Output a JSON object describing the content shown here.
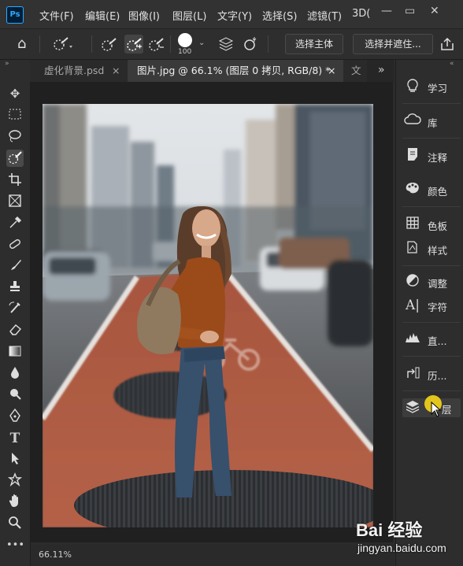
{
  "app": {
    "logo": "Ps",
    "menus": [
      "文件(F)",
      "编辑(E)",
      "图像(I)",
      "图层(L)",
      "文字(Y)",
      "选择(S)",
      "滤镜(T)",
      "3D("
    ]
  },
  "options_bar": {
    "brush_size": "100",
    "select_subject_label": "选择主体",
    "select_mask_label": "选择并遮住..."
  },
  "tabs": [
    {
      "label": "虚化背景.psd",
      "close": "×",
      "active": false
    },
    {
      "label": "图片.jpg @ 66.1% (图层 0 拷贝, RGB/8) *",
      "close": "×",
      "active": true
    },
    {
      "label": "文",
      "active": false
    }
  ],
  "tabs_overflow": "»",
  "panels": [
    {
      "icon": "lightbulb-icon",
      "label": "学习"
    },
    {
      "icon": "library-icon",
      "label": "库"
    },
    {
      "icon": "notes-icon",
      "label": "注释"
    },
    {
      "icon": "color-icon",
      "label": "颜色"
    },
    {
      "icon": "swatches-icon",
      "label": "色板"
    },
    {
      "icon": "styles-icon",
      "label": "样式"
    },
    {
      "icon": "adjustments-icon",
      "label": "调整"
    },
    {
      "icon": "character-icon",
      "label": "字符"
    },
    {
      "icon": "histogram-icon",
      "label": "直..."
    },
    {
      "icon": "history-icon",
      "label": "历..."
    },
    {
      "icon": "layers-icon",
      "label": "层"
    }
  ],
  "status": {
    "zoom": "66.11%"
  },
  "watermark": {
    "brand": "Bai 经验",
    "url": "jingyan.baidu.com"
  },
  "colors": {
    "accent": "#31a8ff",
    "cursor_highlight": "#f2d21b"
  }
}
